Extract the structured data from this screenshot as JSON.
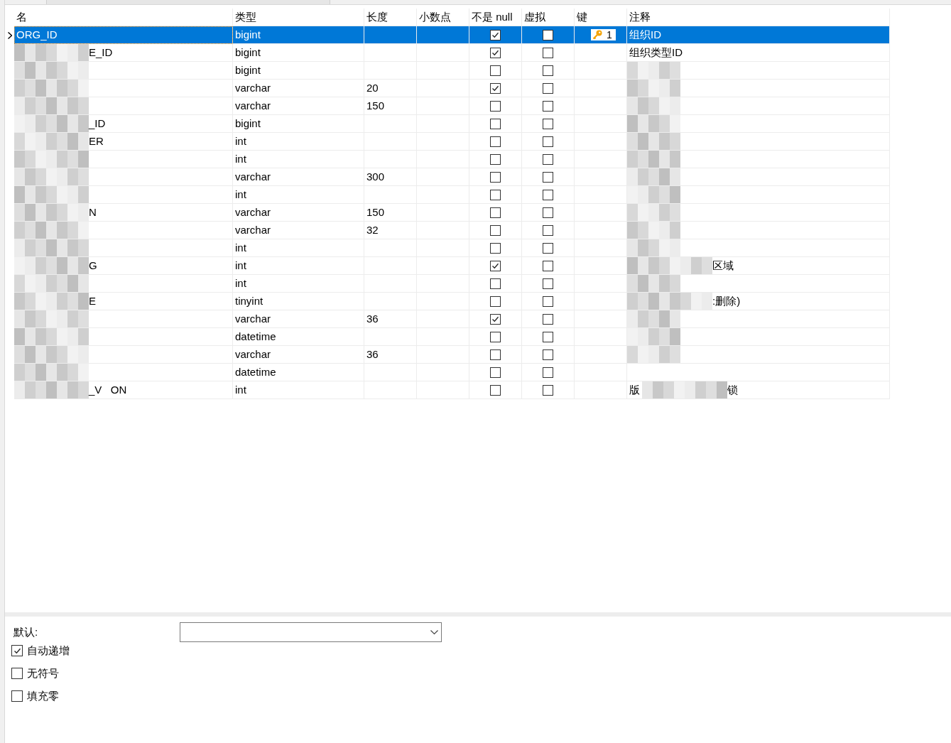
{
  "columns": [
    "名",
    "类型",
    "长度",
    "小数点",
    "不是 null",
    "虚拟",
    "键",
    "注释"
  ],
  "rows": [
    {
      "selected": true,
      "name_before": "ORG_ID",
      "name_masked": false,
      "name_after": "",
      "type": "bigint",
      "length": "",
      "not_null": true,
      "virtual": false,
      "key": "1",
      "comment_before": "组织ID",
      "comment_masked": false,
      "comment_after": ""
    },
    {
      "selected": false,
      "name_before": "",
      "name_masked": true,
      "name_after": "E_ID",
      "type": "bigint",
      "length": "",
      "not_null": true,
      "virtual": false,
      "key": "",
      "comment_before": "组织类型ID",
      "comment_masked": false,
      "comment_after": ""
    },
    {
      "selected": false,
      "name_before": "",
      "name_masked": true,
      "name_after": "",
      "type": "bigint",
      "length": "",
      "not_null": false,
      "virtual": false,
      "key": "",
      "comment_before": "",
      "comment_masked": true,
      "comment_after": ""
    },
    {
      "selected": false,
      "name_before": "",
      "name_masked": true,
      "name_after": "",
      "type": "varchar",
      "length": "20",
      "not_null": true,
      "virtual": false,
      "key": "",
      "comment_before": "",
      "comment_masked": true,
      "comment_after": ""
    },
    {
      "selected": false,
      "name_before": "",
      "name_masked": true,
      "name_after": "",
      "type": "varchar",
      "length": "150",
      "not_null": false,
      "virtual": false,
      "key": "",
      "comment_before": "",
      "comment_masked": true,
      "comment_after": ""
    },
    {
      "selected": false,
      "name_before": "",
      "name_masked": true,
      "name_after": "_ID",
      "type": "bigint",
      "length": "",
      "not_null": false,
      "virtual": false,
      "key": "",
      "comment_before": "",
      "comment_masked": true,
      "comment_after": ""
    },
    {
      "selected": false,
      "name_before": "",
      "name_masked": true,
      "name_after": "ER",
      "type": "int",
      "length": "",
      "not_null": false,
      "virtual": false,
      "key": "",
      "comment_before": "",
      "comment_masked": true,
      "comment_after": ""
    },
    {
      "selected": false,
      "name_before": "",
      "name_masked": true,
      "name_after": "",
      "type": "int",
      "length": "",
      "not_null": false,
      "virtual": false,
      "key": "",
      "comment_before": "",
      "comment_masked": true,
      "comment_after": ""
    },
    {
      "selected": false,
      "name_before": "",
      "name_masked": true,
      "name_after": "",
      "type": "varchar",
      "length": "300",
      "not_null": false,
      "virtual": false,
      "key": "",
      "comment_before": "",
      "comment_masked": true,
      "comment_after": ""
    },
    {
      "selected": false,
      "name_before": "",
      "name_masked": true,
      "name_after": "",
      "type": "int",
      "length": "",
      "not_null": false,
      "virtual": false,
      "key": "",
      "comment_before": "",
      "comment_masked": true,
      "comment_after": ""
    },
    {
      "selected": false,
      "name_before": "",
      "name_masked": true,
      "name_after": "N",
      "type": "varchar",
      "length": "150",
      "not_null": false,
      "virtual": false,
      "key": "",
      "comment_before": "",
      "comment_masked": true,
      "comment_after": ""
    },
    {
      "selected": false,
      "name_before": "",
      "name_masked": true,
      "name_after": "",
      "type": "varchar",
      "length": "32",
      "not_null": false,
      "virtual": false,
      "key": "",
      "comment_before": "",
      "comment_masked": true,
      "comment_after": ""
    },
    {
      "selected": false,
      "name_before": "",
      "name_masked": true,
      "name_after": "",
      "type": "int",
      "length": "",
      "not_null": false,
      "virtual": false,
      "key": "",
      "comment_before": "",
      "comment_masked": true,
      "comment_after": ""
    },
    {
      "selected": false,
      "name_before": "",
      "name_masked": true,
      "name_after": "G",
      "type": "int",
      "length": "",
      "not_null": true,
      "virtual": false,
      "key": "",
      "comment_before": "",
      "comment_masked": true,
      "comment_after": "区域"
    },
    {
      "selected": false,
      "name_before": "",
      "name_masked": true,
      "name_after": "",
      "type": "int",
      "length": "",
      "not_null": false,
      "virtual": false,
      "key": "",
      "comment_before": "",
      "comment_masked": true,
      "comment_after": ""
    },
    {
      "selected": false,
      "name_before": "",
      "name_masked": true,
      "name_after": "E",
      "type": "tinyint",
      "length": "",
      "not_null": false,
      "virtual": false,
      "key": "",
      "comment_before": "",
      "comment_masked": true,
      "comment_after": ":删除)"
    },
    {
      "selected": false,
      "name_before": "",
      "name_masked": true,
      "name_after": "",
      "type": "varchar",
      "length": "36",
      "not_null": true,
      "virtual": false,
      "key": "",
      "comment_before": "",
      "comment_masked": true,
      "comment_after": ""
    },
    {
      "selected": false,
      "name_before": "",
      "name_masked": true,
      "name_after": "",
      "type": "datetime",
      "length": "",
      "not_null": false,
      "virtual": false,
      "key": "",
      "comment_before": "",
      "comment_masked": true,
      "comment_after": ""
    },
    {
      "selected": false,
      "name_before": "",
      "name_masked": true,
      "name_after": "",
      "type": "varchar",
      "length": "36",
      "not_null": false,
      "virtual": false,
      "key": "",
      "comment_before": "",
      "comment_masked": true,
      "comment_after": ""
    },
    {
      "selected": false,
      "name_before": "",
      "name_masked": true,
      "name_after": "",
      "type": "datetime",
      "length": "",
      "not_null": false,
      "virtual": false,
      "key": "",
      "comment_before": "",
      "comment_masked": false,
      "comment_after": ""
    },
    {
      "selected": false,
      "name_before": "",
      "name_masked": true,
      "name_after": "_V   ON",
      "type": "int",
      "length": "",
      "not_null": false,
      "virtual": false,
      "key": "",
      "comment_before": "版",
      "comment_masked": true,
      "comment_after": "锁"
    }
  ],
  "default_label": "默认:",
  "options": [
    {
      "label": "自动递增",
      "checked": true
    },
    {
      "label": "无符号",
      "checked": false
    },
    {
      "label": "填充零",
      "checked": false
    }
  ]
}
